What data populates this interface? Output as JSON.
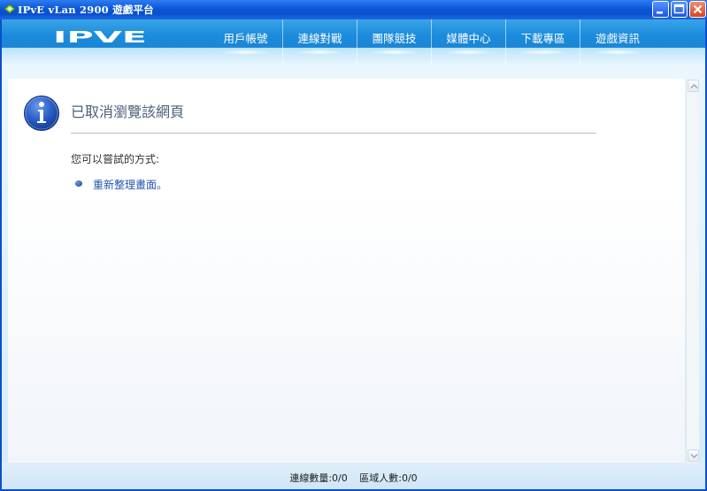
{
  "window": {
    "title": "IPvE vLan 2900 遊戲平台"
  },
  "header": {
    "logo_text": "IPVE",
    "nav": [
      {
        "label": "用戶帳號"
      },
      {
        "label": "連線對戰"
      },
      {
        "label": "團隊競技"
      },
      {
        "label": "媒體中心"
      },
      {
        "label": "下載專區"
      },
      {
        "label": "遊戲資訊"
      }
    ]
  },
  "content": {
    "heading": "已取消瀏覽該網頁",
    "hint": "您可以嘗試的方式:",
    "actions": [
      {
        "label": "重新整理畫面。"
      }
    ]
  },
  "status": {
    "connections_label": "連線數量:0/0",
    "area_users_label": "區域人數:0/0"
  },
  "colors": {
    "titlebar": "#0a57d6",
    "header": "#1c8cdc",
    "link": "#2354b3"
  }
}
